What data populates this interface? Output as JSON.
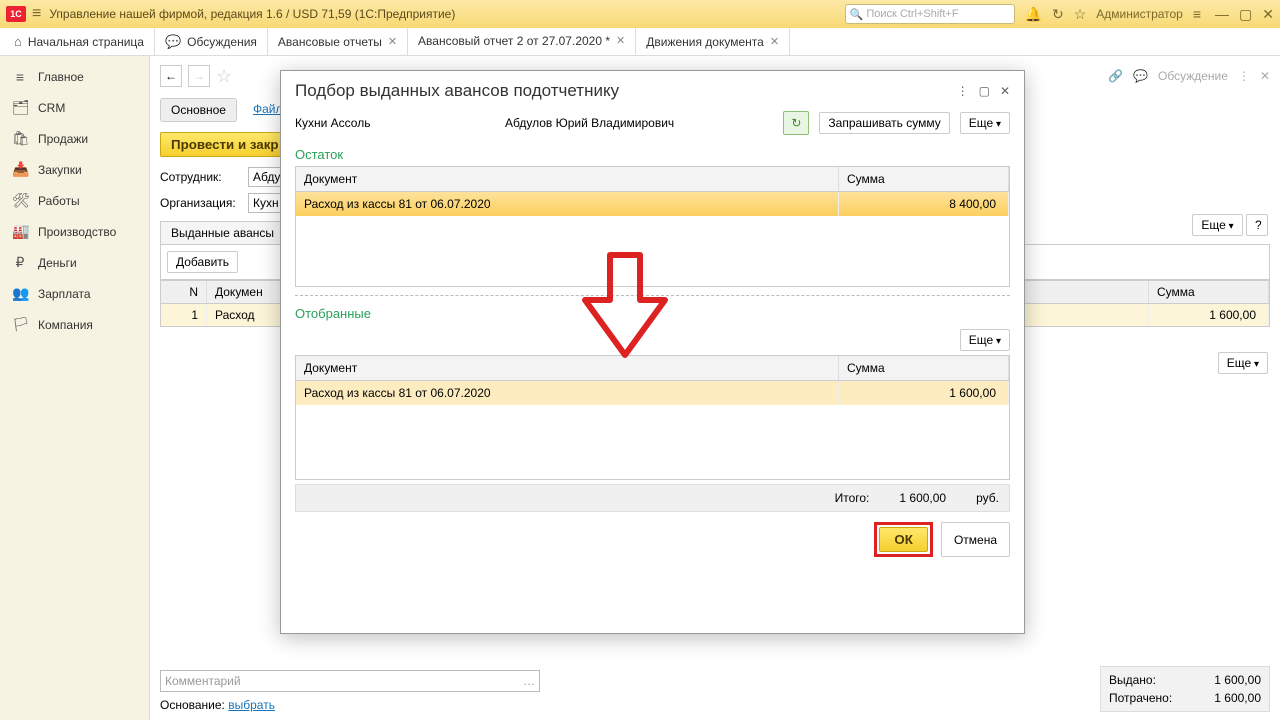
{
  "titlebar": {
    "title": "Управление нашей фирмой, редакция 1.6 / USD 71,59  (1С:Предприятие)",
    "search_placeholder": "Поиск Ctrl+Shift+F",
    "user_label": "Администратор"
  },
  "tabs": {
    "home": "Начальная страница",
    "discuss": "Обсуждения",
    "t1": "Авансовые отчеты",
    "t2": "Авансовый отчет 2 от 27.07.2020 *",
    "t3": "Движения документа"
  },
  "sidebar": {
    "items": [
      {
        "icon": "≡",
        "label": "Главное"
      },
      {
        "icon": "🗂",
        "label": "CRM"
      },
      {
        "icon": "🛍",
        "label": "Продажи"
      },
      {
        "icon": "📥",
        "label": "Закупки"
      },
      {
        "icon": "🛠",
        "label": "Работы"
      },
      {
        "icon": "🏭",
        "label": "Производство"
      },
      {
        "icon": "₽",
        "label": "Деньги"
      },
      {
        "icon": "👥",
        "label": "Зарплата"
      },
      {
        "icon": "🏳",
        "label": "Компания"
      }
    ]
  },
  "content": {
    "main_link": "Основное",
    "files_link": "Файл",
    "discuss_link": "Обсуждение",
    "btn_post": "Провести и закр",
    "btn_more": "Еще",
    "help": "?",
    "employee_label": "Сотрудник:",
    "employee_val": "Абду",
    "org_label": "Организация:",
    "org_val": "Кухн",
    "tab_advances": "Выданные авансы",
    "btn_add": "Добавить",
    "th_n": "N",
    "th_doc": "Докумен",
    "th_sum": "Сумма",
    "row_n": "1",
    "row_doc": "Расход ",
    "row_sum": "1 600,00",
    "comment_ph": "Комментарий",
    "basis_label": "Основание:",
    "basis_link": "выбрать",
    "issued_label": "Выдано:",
    "issued_val": "1 600,00",
    "spent_label": "Потрачено:",
    "spent_val": "1 600,00"
  },
  "dialog": {
    "title": "Подбор выданных авансов подотчетнику",
    "company": "Кухни Ассоль",
    "person": "Абдулов Юрий Владимирович",
    "btn_request": "Запрашивать сумму",
    "btn_more": "Еще",
    "sec_remain": "Остаток",
    "th_doc": "Документ",
    "th_sum": "Сумма",
    "remain_doc": "Расход из кассы 81 от 06.07.2020",
    "remain_sum": "8 400,00",
    "sec_selected": "Отобранные",
    "sel_doc": "Расход из кассы 81 от 06.07.2020",
    "sel_sum": "1 600,00",
    "total_label": "Итого:",
    "total_val": "1 600,00",
    "total_cur": "руб.",
    "btn_ok": "ОК",
    "btn_cancel": "Отмена"
  }
}
